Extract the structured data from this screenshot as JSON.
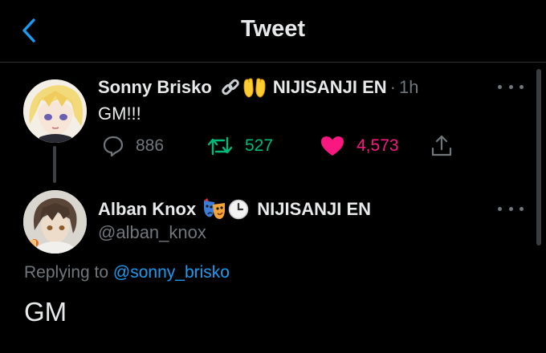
{
  "header": {
    "title": "Tweet",
    "back_icon": "chevron-left-icon",
    "accent": "#1d9bf0"
  },
  "parent_tweet": {
    "display_name": "Sonny Brisko",
    "name_emojis": [
      "link-icon",
      "raised-hands-icon"
    ],
    "affiliation": "NIJISANJI EN",
    "separator": "·",
    "time": "1h",
    "text": "GM!!!",
    "stats": {
      "replies": "886",
      "retweets": "527",
      "likes": "4,573"
    },
    "liked": true,
    "colors": {
      "retweet": "#00ba7c",
      "like": "#f91880"
    }
  },
  "reply_tweet": {
    "display_name": "Alban Knox",
    "name_emojis": [
      "theater-masks-icon",
      "clock-icon"
    ],
    "affiliation": "NIJISANJI EN",
    "handle": "@alban_knox",
    "replying_prefix": "Replying to",
    "replying_to": "@sonny_brisko",
    "text": "GM"
  }
}
